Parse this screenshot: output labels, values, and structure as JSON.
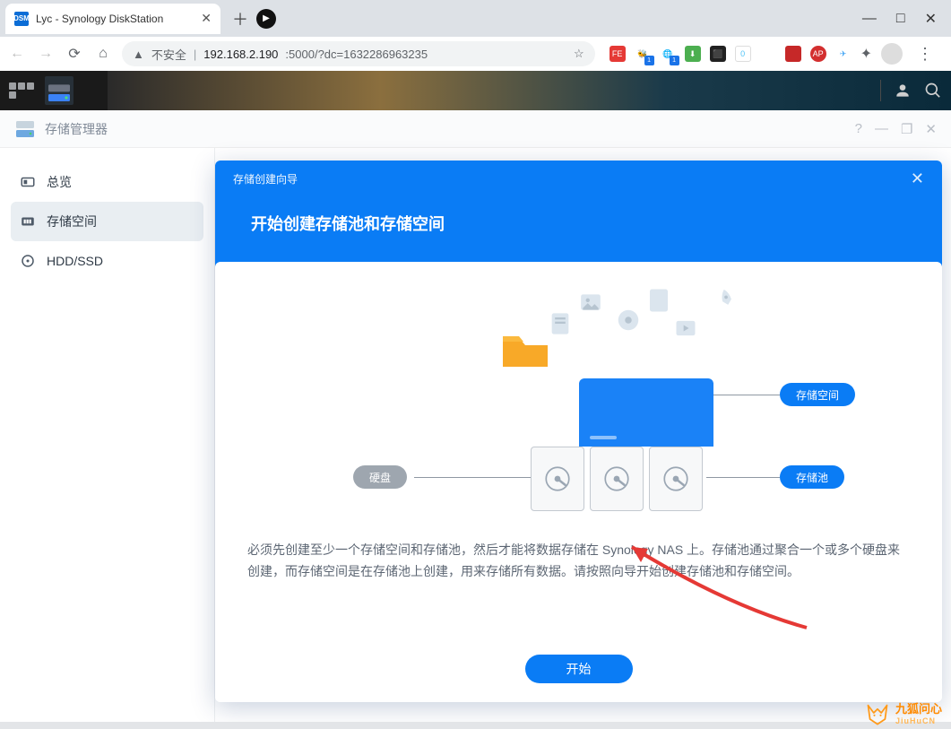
{
  "browser": {
    "tab_title": "Lyc - Synology DiskStation",
    "favicon_text": "DSM",
    "unsafe_label": "不安全",
    "url_host": "192.168.2.190",
    "url_port_path": ":5000/?dc=1632286963235"
  },
  "dsm": {},
  "app": {
    "title": "存储管理器",
    "sidebar": {
      "overview": "总览",
      "storage_volume": "存储空间",
      "hdd_ssd": "HDD/SSD"
    }
  },
  "wizard": {
    "small_title": "存储创建向导",
    "big_title": "开始创建存储池和存储空间",
    "label_hdd": "硬盘",
    "label_volume": "存储空间",
    "label_pool": "存储池",
    "desc": "必须先创建至少一个存储空间和存储池，然后才能将数据存储在 Synology NAS 上。存储池通过聚合一个或多个硬盘来创建，而存储空间是在存储池上创建，用来存储所有数据。请按照向导开始创建存储池和存储空间。",
    "start_button": "开始"
  },
  "watermark": {
    "cn": "九狐问心",
    "en": "JiuHuCN"
  }
}
